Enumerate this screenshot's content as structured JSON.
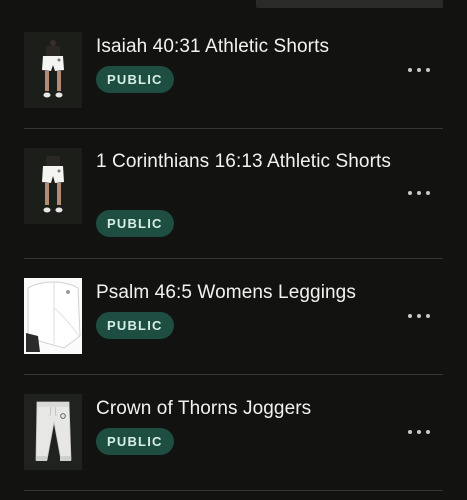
{
  "colors": {
    "background": "#121310",
    "badge_background": "#1e4d42",
    "badge_text": "#d6efe6",
    "title_text": "#f2f2ee",
    "divider": "#35362f"
  },
  "products": [
    {
      "title": "Isaiah 40:31 Athletic Shorts",
      "status": "PUBLIC",
      "thumbnail_icon": "athletic-shorts-model-thumbnail",
      "more_icon": "more-horizontal-icon"
    },
    {
      "title": "1 Corinthians 16:13 Athletic Shorts",
      "status": "PUBLIC",
      "thumbnail_icon": "athletic-shorts-model-thumbnail",
      "more_icon": "more-horizontal-icon"
    },
    {
      "title": "Psalm 46:5 Womens Leggings",
      "status": "PUBLIC",
      "thumbnail_icon": "leggings-thumbnail",
      "more_icon": "more-horizontal-icon"
    },
    {
      "title": "Crown of Thorns Joggers",
      "status": "PUBLIC",
      "thumbnail_icon": "joggers-thumbnail",
      "more_icon": "more-horizontal-icon"
    }
  ]
}
